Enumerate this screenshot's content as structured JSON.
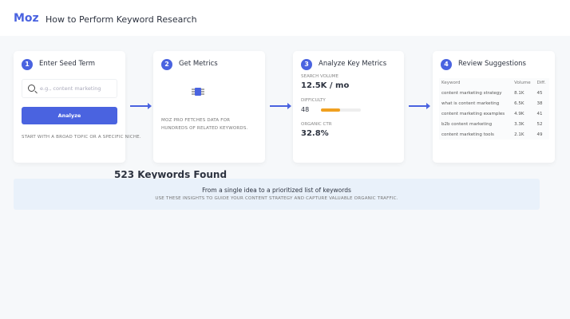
{
  "header": {
    "logo": "Moz",
    "title": "How to Perform Keyword Research"
  },
  "steps": [
    {
      "num": "1",
      "title": "Enter Seed Term",
      "placeholder": "e.g., content marketing",
      "button": "Analyze",
      "note": "START WITH A BROAD TOPIC OR A SPECIFIC NICHE."
    },
    {
      "num": "2",
      "title": "Get Metrics",
      "note_line1": "MOZ PRO FETCHES DATA FOR",
      "note_line2": "HUNDREDS OF RELATED KEYWORDS."
    },
    {
      "num": "3",
      "title": "Analyze Key Metrics",
      "search_volume_label": "SEARCH VOLUME",
      "search_volume": "12.5K / mo",
      "difficulty_label": "DIFFICULTY",
      "difficulty": "48",
      "difficulty_percent": 48,
      "ctr_label": "ORGANIC CTR",
      "ctr": "32.8%"
    },
    {
      "num": "4",
      "title": "Review Suggestions",
      "columns": [
        "Keyword",
        "Volume",
        "Diff."
      ],
      "rows": [
        [
          "content marketing strategy",
          "8.1K",
          "45"
        ],
        [
          "what is content marketing",
          "6.5K",
          "38"
        ],
        [
          "content marketing examples",
          "4.9K",
          "41"
        ],
        [
          "b2b content marketing",
          "3.3K",
          "52"
        ],
        [
          "content marketing tools",
          "2.1K",
          "49"
        ]
      ]
    }
  ],
  "overlay": "523 Keywords Found",
  "banner": {
    "title": "From a single idea to a prioritized list of keywords",
    "subtitle": "USE THESE INSIGHTS TO GUIDE YOUR CONTENT STRATEGY AND CAPTURE VALUABLE ORGANIC TRAFFIC."
  }
}
